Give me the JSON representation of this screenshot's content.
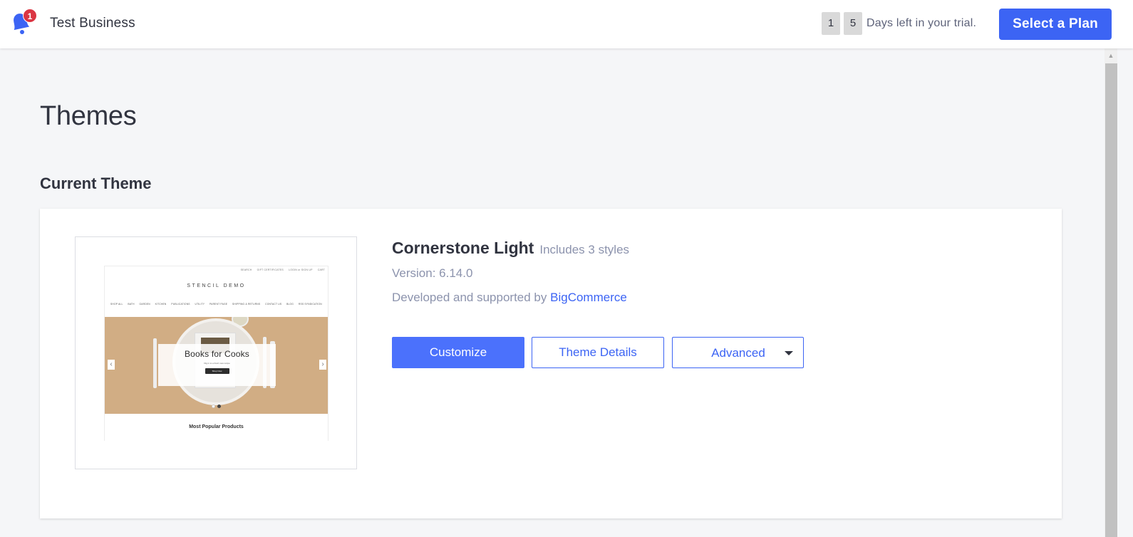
{
  "topbar": {
    "notification_count": "1",
    "business_name": "Test Business",
    "trial_days_digits": [
      "1",
      "5"
    ],
    "trial_text": "Days left in your trial.",
    "select_plan_label": "Select a Plan"
  },
  "page": {
    "title": "Themes",
    "section_title": "Current Theme"
  },
  "theme": {
    "name": "Cornerstone Light",
    "styles_note": "Includes 3 styles",
    "version_text": "Version: 6.14.0",
    "developer_prefix": "Developed and supported by",
    "developer_link": "BigCommerce",
    "buttons": {
      "customize": "Customize",
      "theme_details": "Theme Details",
      "advanced": "Advanced"
    }
  },
  "preview": {
    "utility_links": [
      "SEARCH",
      "GIFT CERTIFICATES",
      "LOGIN or SIGN UP",
      "CART"
    ],
    "store_logo": "STENCIL DEMO",
    "nav_items": [
      "SHOP ALL",
      "BATH",
      "GARDEN",
      "KITCHEN",
      "PUBLICATIONS",
      "UTILITY",
      "PARENT PAGE",
      "SHIPPING & RETURNS",
      "CONTACT US",
      "BLOG",
      "RSS SYNDICATION"
    ],
    "hero_title": "Books for Cooks",
    "hero_subtitle": "Dig in to a fresh new recipe",
    "hero_button": "Shop Now",
    "section_heading": "Most Popular Products"
  },
  "colors": {
    "accent": "#3c64f4",
    "primary_button": "#4b71fc",
    "badge": "#db3643",
    "background": "#f5f6f8",
    "muted_text": "#8c93ad"
  }
}
